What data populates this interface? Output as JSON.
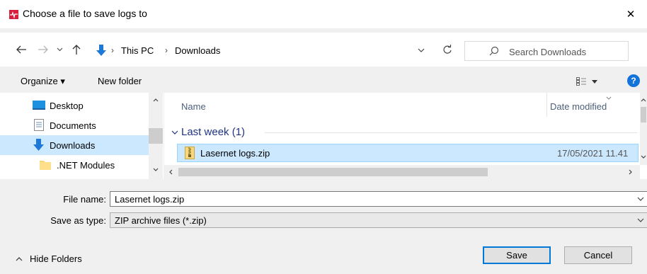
{
  "window": {
    "title": "Choose a file to save logs to",
    "close_glyph": "✕"
  },
  "navigation": {
    "back_icon": "arrow-left-icon",
    "forward_icon": "arrow-right-icon",
    "recent_icon": "chevron-down-icon",
    "up_icon": "arrow-up-icon",
    "breadcrumb": [
      "This PC",
      "Downloads"
    ],
    "breadcrumb_sep": "›",
    "search_placeholder": "Search Downloads"
  },
  "toolbar": {
    "organize_label": "Organize ▾",
    "new_folder_label": "New folder",
    "help_label": "?"
  },
  "sidebar": {
    "items": [
      {
        "label": "Desktop",
        "icon": "desktop-icon"
      },
      {
        "label": "Documents",
        "icon": "documents-icon"
      },
      {
        "label": "Downloads",
        "icon": "downloads-icon",
        "selected": true
      },
      {
        "label": ".NET Modules",
        "icon": "folder-icon"
      }
    ]
  },
  "file_list": {
    "columns": [
      "Name",
      "Date modified"
    ],
    "group_label": "Last week (1)",
    "rows": [
      {
        "name": "Lasernet logs.zip",
        "date": "17/05/2021 11.41",
        "icon": "zip-icon"
      }
    ]
  },
  "form": {
    "file_name_label": "File name:",
    "file_name_value": "Lasernet logs.zip",
    "save_type_label": "Save as type:",
    "save_type_value": "ZIP archive files (*.zip)"
  },
  "footer": {
    "hide_folders_label": "Hide Folders",
    "save_label": "Save",
    "cancel_label": "Cancel"
  },
  "colors": {
    "accent": "#0078d7",
    "selection": "#cce8ff",
    "app_icon": "#d81e3a",
    "download_arrow": "#1e78d8",
    "group_text": "#1e3287"
  }
}
